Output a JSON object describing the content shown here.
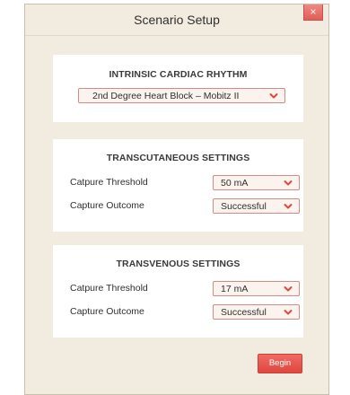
{
  "window": {
    "title": "Scenario Setup",
    "close_label": "×"
  },
  "intrinsic": {
    "heading": "INTRINSIC CARDIAC RHYTHM",
    "rhythm_value": "2nd Degree Heart Block – Mobitz II"
  },
  "transcutaneous": {
    "heading": "TRANSCUTANEOUS SETTINGS",
    "threshold_label": "Catpure Threshold",
    "threshold_value": "50 mA",
    "outcome_label": "Capture Outcome",
    "outcome_value": "Successful"
  },
  "transvenous": {
    "heading": "TRANSVENOUS SETTINGS",
    "threshold_label": "Catpure Threshold",
    "threshold_value": "17 mA",
    "outcome_label": "Capture Outcome",
    "outcome_value": "Successful"
  },
  "actions": {
    "begin_label": "Begin"
  },
  "icons": {
    "dropdown": "chevron-down-icon",
    "close": "close-icon"
  },
  "colors": {
    "accent": "#e0463e",
    "dialog_bg": "#f2ece0",
    "select_border": "#d48a85"
  }
}
